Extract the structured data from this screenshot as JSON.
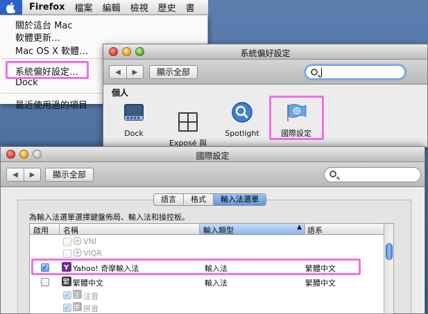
{
  "menubar": {
    "app_name": "Firefox",
    "menus": [
      "檔案",
      "編輯",
      "檢視",
      "歷史",
      "書"
    ]
  },
  "apple_menu": {
    "items": [
      "關於這台 Mac",
      "軟體更新…",
      "Mac OS X 軟體…",
      "系統偏好設定…",
      "Dock",
      "最近使用過的項目"
    ]
  },
  "sysprefs": {
    "title": "系統偏好設定",
    "show_all": "顯示全部",
    "search_value": "",
    "section": "個人",
    "items": [
      "Dock",
      "Exposé 與\nSpaces",
      "Spotlight",
      "國際設定"
    ]
  },
  "intl": {
    "title": "國際設定",
    "show_all": "顯示全部",
    "tabs": [
      "語言",
      "格式",
      "輸入法選單"
    ],
    "selected_tab": "輸入法選單",
    "description": "為輸入法選單選擇鍵盤佈局、輸入法和操控板。",
    "columns": [
      "啟用",
      "名稱",
      "輸入類型",
      "語系"
    ],
    "rows": [
      {
        "name": "VNI",
        "type": "",
        "lang": "",
        "checked": false,
        "dim": true
      },
      {
        "name": "VIQR",
        "type": "",
        "lang": "",
        "checked": false,
        "dim": true
      },
      {
        "name": "Yahoo! 奇摩輸入法",
        "type": "輸入法",
        "lang": "繁體中文",
        "checked": true,
        "dim": false
      },
      {
        "name": "繁體中文",
        "type": "輸入法",
        "lang": "繁體中文",
        "checked": false,
        "dim": false
      },
      {
        "name": "注音",
        "type": "",
        "lang": "",
        "checked": true,
        "dim": true
      },
      {
        "name": "拼音",
        "type": "",
        "lang": "",
        "checked": true,
        "dim": true
      }
    ]
  },
  "colors": {
    "highlight": "#f26ee8",
    "selection": "#5f96de",
    "desktop": "#4a6a9a"
  }
}
